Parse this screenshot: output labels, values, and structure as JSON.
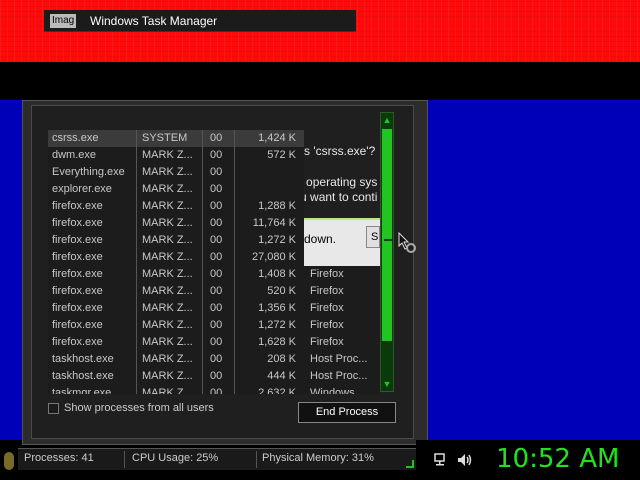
{
  "window_title": "Windows Task Manager",
  "title_icon_text": "Imag",
  "processes": [
    {
      "name": "csrss.exe",
      "user": "SYSTEM",
      "cpu": "00",
      "mem": "1,424 K",
      "selected": true
    },
    {
      "name": "dwm.exe",
      "user": "MARK Z...",
      "cpu": "00",
      "mem": "572 K"
    },
    {
      "name": "Everything.exe",
      "user": "MARK Z...",
      "cpu": "00",
      "mem": ""
    },
    {
      "name": "explorer.exe",
      "user": "MARK Z...",
      "cpu": "00",
      "mem": ""
    },
    {
      "name": "firefox.exe",
      "user": "MARK Z...",
      "cpu": "00",
      "mem": "1,288 K"
    },
    {
      "name": "firefox.exe",
      "user": "MARK Z...",
      "cpu": "00",
      "mem": "11,764 K"
    },
    {
      "name": "firefox.exe",
      "user": "MARK Z...",
      "cpu": "00",
      "mem": "1,272 K"
    },
    {
      "name": "firefox.exe",
      "user": "MARK Z...",
      "cpu": "00",
      "mem": "27,080 K"
    },
    {
      "name": "firefox.exe",
      "user": "MARK Z...",
      "cpu": "00",
      "mem": "1,408 K"
    },
    {
      "name": "firefox.exe",
      "user": "MARK Z...",
      "cpu": "00",
      "mem": "520 K"
    },
    {
      "name": "firefox.exe",
      "user": "MARK Z...",
      "cpu": "00",
      "mem": "1,356 K"
    },
    {
      "name": "firefox.exe",
      "user": "MARK Z...",
      "cpu": "00",
      "mem": "1,272 K"
    },
    {
      "name": "firefox.exe",
      "user": "MARK Z...",
      "cpu": "00",
      "mem": "1,628 K"
    },
    {
      "name": "taskhost.exe",
      "user": "MARK Z...",
      "cpu": "00",
      "mem": "208 K"
    },
    {
      "name": "taskhost.exe",
      "user": "MARK Z...",
      "cpu": "00",
      "mem": "444 K"
    },
    {
      "name": "taskmgr.exe",
      "user": "MARK Z...",
      "cpu": "00",
      "mem": "2,632 K"
    }
  ],
  "descriptions": [
    "Firefox",
    "Firefox",
    "Firefox",
    "Firefox",
    "Firefox",
    "Host Proc...",
    "Host Proc...",
    "Windows..."
  ],
  "dialog": {
    "line1": "s 'csrss.exe'?",
    "line2": "hut down the operating sys",
    "line3": "you sure you want to conti",
    "shut_text": "down.",
    "button_text": "S"
  },
  "show_all_label": "Show processes from all users",
  "end_process_label": "End Process",
  "status": {
    "processes": "Processes: 41",
    "cpu": "CPU Usage: 25%",
    "memory": "Physical Memory: 31%"
  },
  "clock": "10:52 AM",
  "colors": {
    "accent": "#22c322",
    "desktop": "#0000b8",
    "top_bar": "#ff0a0a"
  }
}
